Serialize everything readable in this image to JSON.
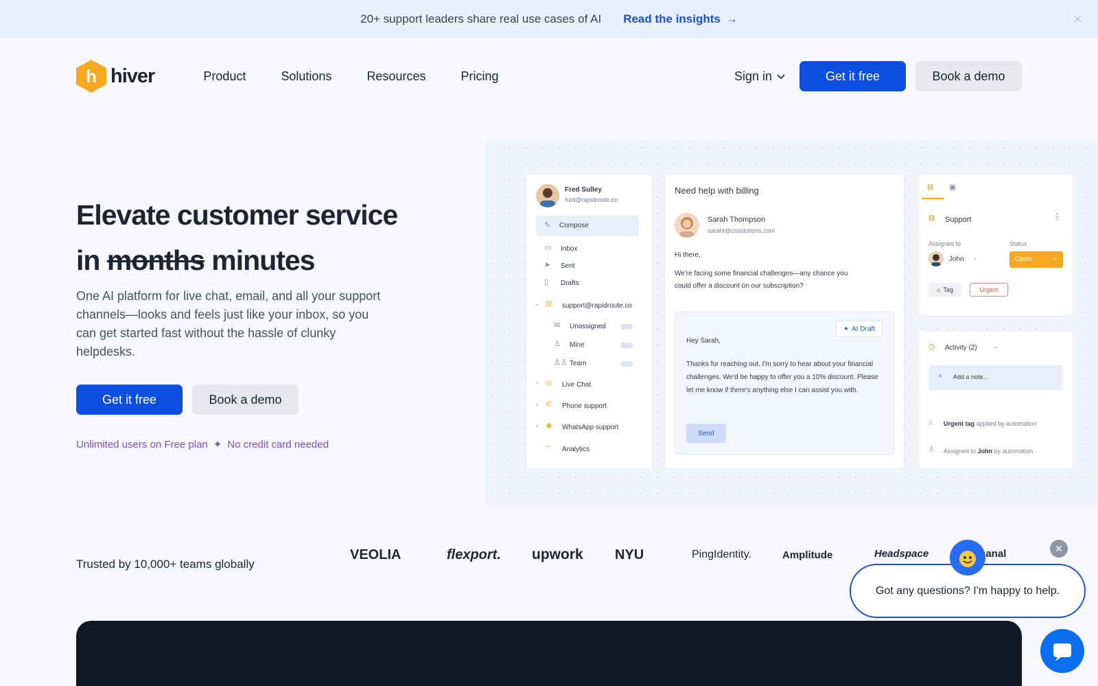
{
  "banner": {
    "text": "20+ support leaders share real use cases of AI",
    "link": "Read the insights",
    "arrow": "→",
    "close": "✕"
  },
  "nav": {
    "logo_mark": "h",
    "logo_text": "hiver",
    "items": [
      "Product",
      "Solutions",
      "Resources",
      "Pricing"
    ],
    "sign_in": "Sign in",
    "get_free": "Get it free",
    "book_demo": "Book a demo"
  },
  "hero": {
    "title_line1": "Elevate customer service",
    "title_in": "in",
    "title_struck": "months",
    "title_minutes": "minutes",
    "subtitle": "One AI platform for live chat, email, and all your support channels—looks and feels just like your inbox, so you can get started fast without the hassle of clunky helpdesks.",
    "cta_primary": "Get it free",
    "cta_secondary": "Book a demo",
    "note_left": "Unlimited users on Free plan",
    "note_star": "✦",
    "note_right": "No credit card needed"
  },
  "mock": {
    "user_name": "Fred Sulley",
    "user_email": "fred@rapidroute.co",
    "compose": "Compose",
    "inbox": "Inbox",
    "sent": "Sent",
    "drafts": "Drafts",
    "support_email": "support@rapidroute.co",
    "unassigned": "Unassigned",
    "mine": "Mine",
    "team": "Team",
    "live_chat": "Live Chat",
    "phone_support": "Phone support",
    "whatsapp_support": "WhatsApp support",
    "analytics": "Analytics",
    "email_subject": "Need help with billing",
    "sender_name": "Sarah Thompson",
    "sender_email": "saraht@cssolutions.com",
    "greeting": "Hi there,",
    "body": "We're facing some financial challenges—any chance you could offer a discount on our subscription?",
    "ai_draft": "AI Draft",
    "reply_greeting": "Hey Sarah,",
    "reply_body": "Thanks for reaching out. I'm sorry to hear about your financial challenges. We'd be happy to offer you a 10% discount. Please let me know if there's anything else I can assist you with.",
    "send": "Send",
    "support": "Support",
    "assigned_to_label": "Assigned to",
    "assignee": "John",
    "status_label": "Status",
    "status": "Open",
    "tag": "Tag",
    "urgent": "Urgent",
    "activity": "Activity (2)",
    "add_note": "Add a note...",
    "log1_bold": "Urgent tag",
    "log1_rest": "applied by automation",
    "log2_pre": "Assigned to",
    "log2_bold": "John",
    "log2_rest": "by automation",
    "status_color": "#f7a823"
  },
  "trust": {
    "label": "Trusted by 10,000+ teams globally",
    "logos": [
      "VEOLIA",
      "flexport.",
      "upwork",
      "NYU",
      "PingIdentity.",
      "Amplitude",
      "Headspace",
      "canal"
    ]
  },
  "chat": {
    "message": "Got any questions? I'm happy to help.",
    "close": "✕"
  }
}
